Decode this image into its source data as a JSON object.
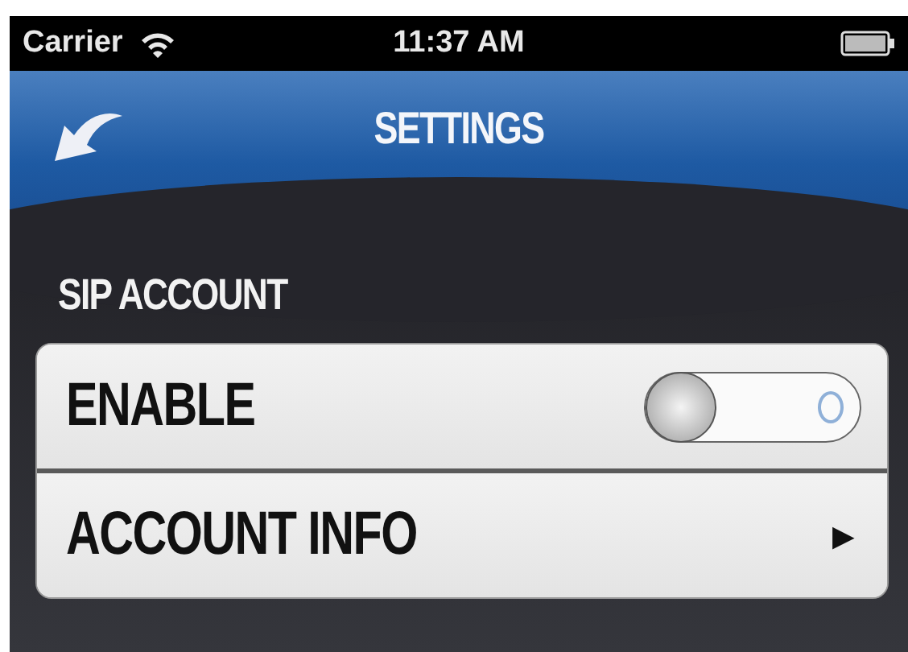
{
  "status_bar": {
    "carrier": "Carrier",
    "time": "11:37 AM"
  },
  "nav_bar": {
    "title": "SETTINGS"
  },
  "section": {
    "title": "SIP ACCOUNT"
  },
  "rows": [
    {
      "kind": "toggle",
      "label": "ENABLE",
      "on": false
    },
    {
      "kind": "disclosure",
      "label": "ACCOUNT INFO",
      "arrow": "▶"
    }
  ]
}
